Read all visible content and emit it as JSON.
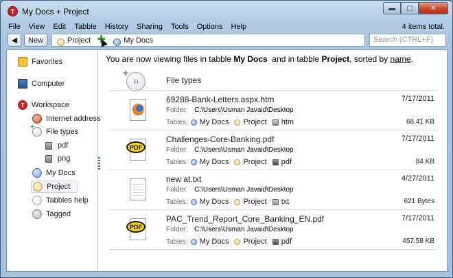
{
  "window": {
    "title": "My Docs  +  Project",
    "controls": {
      "minimize": "▬",
      "maximize": "▢",
      "close": "✕"
    }
  },
  "menu": [
    "File",
    "View",
    "Edit",
    "Tabble",
    "History",
    "Sharing",
    "Tools",
    "Options",
    "Help"
  ],
  "items_total": "4 items total.",
  "toolbar": {
    "back": "◀",
    "new_label": "New",
    "tabs": [
      {
        "label": "Project",
        "icon": "project-dot-icon"
      },
      {
        "label": "My Docs",
        "icon": "mydocs-dot-icon"
      }
    ],
    "search_placeholder": "Search (CTRL+F)"
  },
  "sidebar": {
    "favorites": "Favorites",
    "computer": "Computer",
    "workspace": "Workspace",
    "items": [
      {
        "label": "Internet address",
        "icon": "internet-address-icon"
      },
      {
        "label": "File types",
        "icon": "file-types-icon"
      },
      {
        "label": "pdf",
        "icon": "file-icon"
      },
      {
        "label": "png",
        "icon": "file-icon"
      },
      {
        "label": "My Docs",
        "icon": "mydocs-icon"
      },
      {
        "label": "Project",
        "icon": "project-icon"
      },
      {
        "label": "Tabbles help",
        "icon": "help-icon"
      },
      {
        "label": "Tagged",
        "icon": "tagged-icon"
      }
    ]
  },
  "status": {
    "prefix": "You are now viewing files in tabble",
    "tabble1": "My Docs",
    "middle": "and  in tabble",
    "tabble2": "Project",
    "sorted": ", sorted by",
    "sort_key": "name",
    "suffix": "."
  },
  "file_types_header": {
    "label": "File types",
    "icon_text": "Fi"
  },
  "labels": {
    "folder": "Folder:",
    "tables": "Tables:"
  },
  "files": [
    {
      "name": "69288-Bank-Letters.aspx.htm",
      "date": "7/17/2011",
      "folder": "C:\\Users\\Usman Javaid\\Desktop",
      "tags": [
        "My Docs",
        "Project",
        "htm"
      ],
      "size": "68.41 KB"
    },
    {
      "name": "Challenges-Core-Banking.pdf",
      "date": "7/17/2011",
      "folder": "C:\\Users\\Usman Javaid\\Desktop",
      "tags": [
        "My Docs",
        "Project",
        "pdf"
      ],
      "size": "84 KB"
    },
    {
      "name": "new at.txt",
      "date": "4/27/2011",
      "folder": "C:\\Users\\Usman Javaid\\Desktop",
      "tags": [
        "My Docs",
        "Project",
        "txt"
      ],
      "size": "621 Bytes"
    },
    {
      "name": "PAC_Trend_Report_Core_Banking_EN.pdf",
      "date": "7/17/2011",
      "folder": "C:\\Users\\Usman Javaid\\Desktop",
      "tags": [
        "My Docs",
        "Project",
        "pdf"
      ],
      "size": "457.58 KB"
    }
  ],
  "icon_text": {
    "pdf_badge": "PDF",
    "workspace_logo": "T"
  }
}
